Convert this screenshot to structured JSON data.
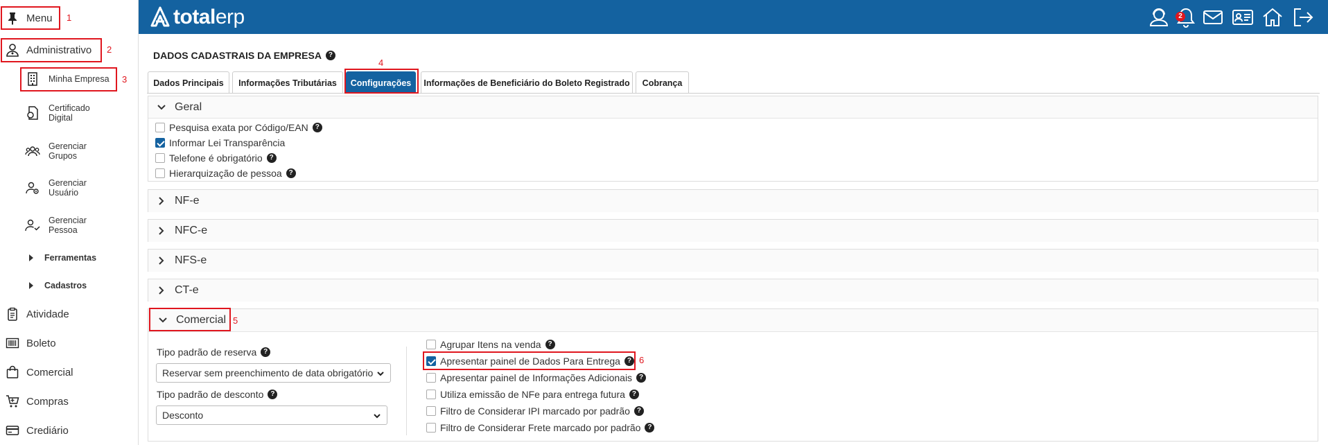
{
  "sidebar": {
    "menu_label": "Menu",
    "admin_label": "Administrativo",
    "sub_items": [
      {
        "label": "Minha Empresa"
      },
      {
        "label": "Certificado Digital"
      },
      {
        "label": "Gerenciar Grupos"
      },
      {
        "label": "Gerenciar Usuário"
      },
      {
        "label": "Gerenciar Pessoa"
      }
    ],
    "ferramentas_label": "Ferramentas",
    "cadastros_label": "Cadastros",
    "modules": [
      {
        "label": "Atividade"
      },
      {
        "label": "Boleto"
      },
      {
        "label": "Comercial"
      },
      {
        "label": "Compras"
      },
      {
        "label": "Crediário"
      }
    ]
  },
  "header": {
    "logo_bold": "total",
    "logo_light": "erp",
    "notification_count": "2",
    "icons": [
      "support-icon",
      "bell-icon",
      "mail-icon",
      "id-card-icon",
      "home-icon",
      "logout-icon"
    ]
  },
  "page": {
    "title": "DADOS CADASTRAIS DA EMPRESA",
    "tabs": [
      {
        "label": "Dados Principais"
      },
      {
        "label": "Informações Tributárias"
      },
      {
        "label": "Configurações"
      },
      {
        "label": "Informações de Beneficiário do Boleto Registrado"
      },
      {
        "label": "Cobrança"
      }
    ],
    "active_tab": "Configurações"
  },
  "geral": {
    "title": "Geral",
    "options": [
      {
        "label": "Pesquisa exata por Código/EAN",
        "checked": false
      },
      {
        "label": "Informar Lei Transparência",
        "checked": true
      },
      {
        "label": "Telefone é obrigatório",
        "checked": false
      },
      {
        "label": "Hierarquização de pessoa",
        "checked": false
      }
    ]
  },
  "sections": [
    {
      "title": "NF-e"
    },
    {
      "title": "NFC-e"
    },
    {
      "title": "NFS-e"
    },
    {
      "title": "CT-e"
    }
  ],
  "comercial": {
    "title": "Comercial",
    "reserva_label": "Tipo padrão de reserva",
    "reserva_value": "Reservar sem preenchimento de data obrigatório",
    "desconto_label": "Tipo padrão de desconto",
    "desconto_value": "Desconto",
    "options": [
      {
        "label": "Agrupar Itens na venda",
        "checked": false
      },
      {
        "label": "Apresentar painel de Dados Para Entrega",
        "checked": true
      },
      {
        "label": "Apresentar painel de Informações Adicionais",
        "checked": false
      },
      {
        "label": "Utiliza emissão de NFe para entrega futura",
        "checked": false
      },
      {
        "label": "Filtro de Considerar IPI marcado por padrão",
        "checked": false
      },
      {
        "label": "Filtro de Considerar Frete marcado por padrão",
        "checked": false
      }
    ]
  },
  "annotations": [
    "1",
    "2",
    "3",
    "4",
    "5",
    "6"
  ],
  "colors": {
    "brand": "#1462a0",
    "highlight": "#e0161e"
  }
}
